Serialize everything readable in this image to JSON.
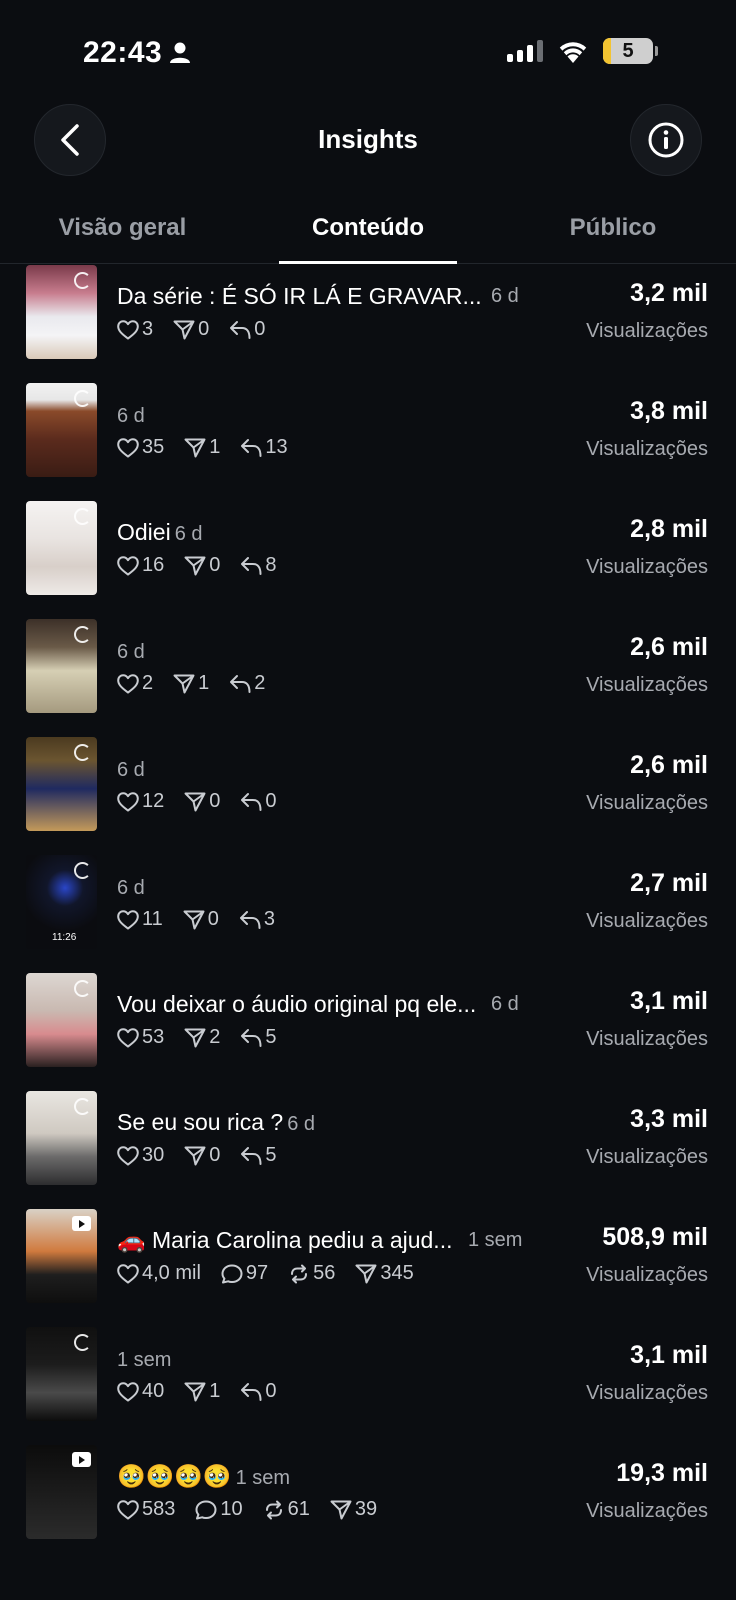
{
  "status_bar": {
    "time": "22:43",
    "battery": "5"
  },
  "header": {
    "title": "Insights"
  },
  "tabs": [
    {
      "label": "Visão geral",
      "active": false
    },
    {
      "label": "Conteúdo",
      "active": true
    },
    {
      "label": "Público",
      "active": false
    }
  ],
  "items": [
    {
      "title": "Da série : É SÓ IR LÁ E GRAVAR...",
      "age": "6 d",
      "stats": {
        "likes": "3",
        "shares": "0",
        "replies": "0"
      },
      "views": "3,2 mil",
      "views_label": "Visualizações"
    },
    {
      "title": "",
      "age": "6 d",
      "stats": {
        "likes": "35",
        "shares": "1",
        "replies": "13"
      },
      "views": "3,8 mil",
      "views_label": "Visualizações"
    },
    {
      "title": "Odiei",
      "age": "6 d",
      "stats": {
        "likes": "16",
        "shares": "0",
        "replies": "8"
      },
      "views": "2,8 mil",
      "views_label": "Visualizações"
    },
    {
      "title": "",
      "age": "6 d",
      "stats": {
        "likes": "2",
        "shares": "1",
        "replies": "2"
      },
      "views": "2,6 mil",
      "views_label": "Visualizações"
    },
    {
      "title": "",
      "age": "6 d",
      "stats": {
        "likes": "12",
        "shares": "0",
        "replies": "0"
      },
      "views": "2,6 mil",
      "views_label": "Visualizações"
    },
    {
      "title": "",
      "age": "6 d",
      "stats": {
        "likes": "11",
        "shares": "0",
        "replies": "3"
      },
      "views": "2,7 mil",
      "views_label": "Visualizações",
      "thumb_text": "11:26"
    },
    {
      "title": "Vou deixar o áudio original pq ele...",
      "age": "6 d",
      "stats": {
        "likes": "53",
        "shares": "2",
        "replies": "5"
      },
      "views": "3,1 mil",
      "views_label": "Visualizações"
    },
    {
      "title": "Se eu sou rica ?",
      "age": "6 d",
      "stats": {
        "likes": "30",
        "shares": "0",
        "replies": "5"
      },
      "views": "3,3 mil",
      "views_label": "Visualizações"
    },
    {
      "title": "🚗 Maria Carolina pediu a ajud...",
      "age": "1 sem",
      "stats": {
        "likes": "4,0 mil",
        "comments": "97",
        "reposts": "56",
        "shares": "345"
      },
      "views": "508,9 mil",
      "views_label": "Visualizações"
    },
    {
      "title": "",
      "age": "1 sem",
      "stats": {
        "likes": "40",
        "shares": "1",
        "replies": "0"
      },
      "views": "3,1 mil",
      "views_label": "Visualizações"
    },
    {
      "title": "🥹🥹🥹🥹",
      "age": "1 sem",
      "stats": {
        "likes": "583",
        "comments": "10",
        "reposts": "61",
        "shares": "39"
      },
      "views": "19,3 mil",
      "views_label": "Visualizações"
    }
  ],
  "colors": {
    "background": "#0b0d11",
    "muted_text": "#a7aab0",
    "text": "#ffffff"
  },
  "icons": [
    "back-icon",
    "info-icon",
    "heart-icon",
    "share-icon",
    "reply-icon",
    "comment-icon",
    "repost-icon"
  ]
}
